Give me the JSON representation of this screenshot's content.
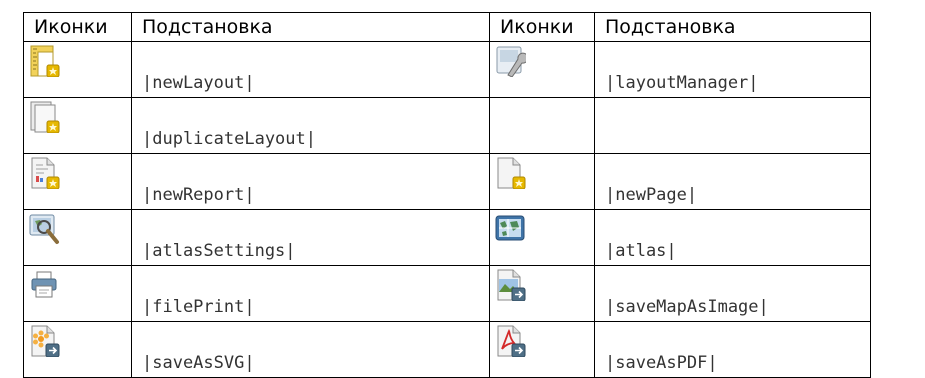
{
  "headers": [
    "Иконки",
    "Подстановка",
    "Иконки",
    "Подстановка"
  ],
  "rows": [
    {
      "left": {
        "icon": "new-layout-icon",
        "code": "|newLayout|"
      },
      "right": {
        "icon": "layout-manager-icon",
        "code": "|layoutManager|"
      }
    },
    {
      "left": {
        "icon": "duplicate-layout-icon",
        "code": "|duplicateLayout|"
      },
      "right": {
        "icon": "",
        "code": ""
      }
    },
    {
      "left": {
        "icon": "new-report-icon",
        "code": "|newReport|"
      },
      "right": {
        "icon": "new-page-icon",
        "code": "|newPage|"
      }
    },
    {
      "left": {
        "icon": "atlas-settings-icon",
        "code": "|atlasSettings|"
      },
      "right": {
        "icon": "atlas-icon",
        "code": "|atlas|"
      }
    },
    {
      "left": {
        "icon": "file-print-icon",
        "code": "|filePrint|"
      },
      "right": {
        "icon": "save-map-as-image-icon",
        "code": "|saveMapAsImage|"
      }
    },
    {
      "left": {
        "icon": "save-as-svg-icon",
        "code": "|saveAsSVG|"
      },
      "right": {
        "icon": "save-as-pdf-icon",
        "code": "|saveAsPDF|"
      }
    }
  ]
}
